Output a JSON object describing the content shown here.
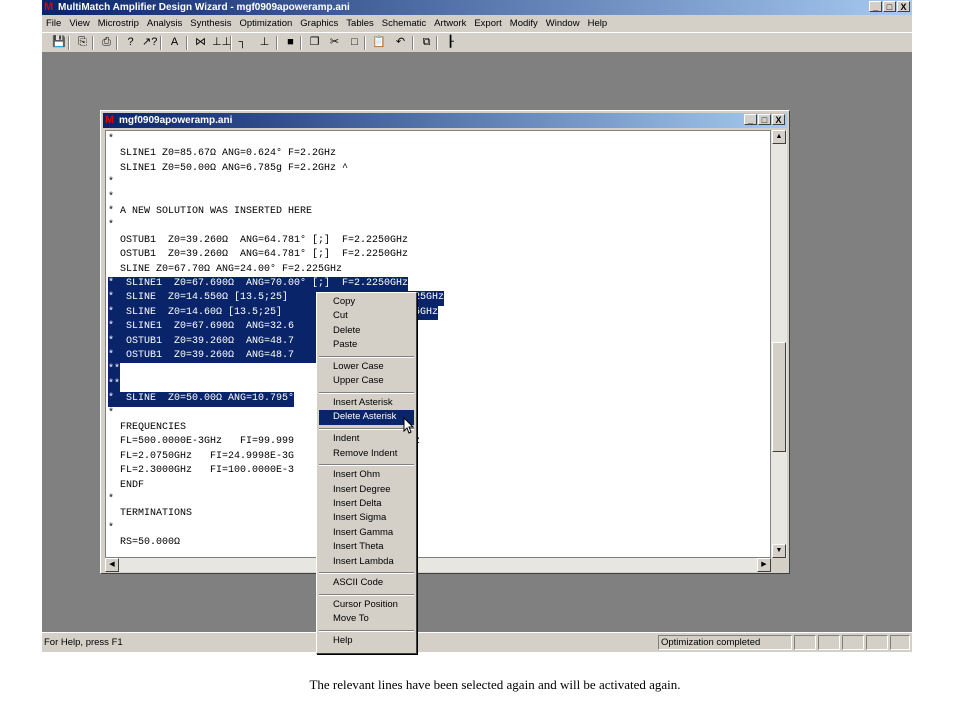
{
  "window": {
    "title": "MultiMatch Amplifier Design Wizard - mgf0909apoweramp.ani",
    "logo_glyph": "M",
    "controls": [
      "_",
      "□",
      "X"
    ]
  },
  "menu": [
    "File",
    "View",
    "Microstrip",
    "Analysis",
    "Synthesis",
    "Optimization",
    "Graphics",
    "Tables",
    "Schematic",
    "Artwork",
    "Export",
    "Modify",
    "Window",
    "Help"
  ],
  "toolbar_icons": [
    {
      "name": "save-icon",
      "glyph": "💾"
    },
    {
      "name": "open-icon",
      "glyph": "⎘"
    },
    {
      "name": "print-icon",
      "glyph": "⎙"
    },
    {
      "name": "help-icon",
      "glyph": "?"
    },
    {
      "name": "context-help-icon",
      "glyph": "↗?"
    },
    {
      "name": "amplifier-icon",
      "glyph": "A"
    },
    {
      "name": "ff-icon",
      "glyph": "⋈"
    },
    {
      "name": "tt-icon",
      "glyph": "⊥⊥"
    },
    {
      "name": "stub-icon",
      "glyph": "┐"
    },
    {
      "name": "ground-icon",
      "glyph": "⊥"
    },
    {
      "name": "block-icon",
      "glyph": "■"
    },
    {
      "name": "copy-icon",
      "glyph": "❐"
    },
    {
      "name": "cut-icon",
      "glyph": "✂"
    },
    {
      "name": "square-icon",
      "glyph": "□"
    },
    {
      "name": "paste-icon",
      "glyph": "📋"
    },
    {
      "name": "undo-icon",
      "glyph": "↶"
    },
    {
      "name": "frame-icon",
      "glyph": "⧉"
    },
    {
      "name": "pointer-icon",
      "glyph": "┠"
    }
  ],
  "document": {
    "title": "mgf0909apoweramp.ani",
    "logo_glyph": "M",
    "lines": [
      {
        "text": "*",
        "sel": false
      },
      {
        "text": "  SLINE1 Z0=85.67Ω ANG=0.624° F=2.2GHz",
        "sel": false
      },
      {
        "text": "  SLINE1 Z0=50.00Ω ANG=6.785g F=2.2GHz ^",
        "sel": false
      },
      {
        "text": "*",
        "sel": false
      },
      {
        "text": "*",
        "sel": false
      },
      {
        "text": "* A NEW SOLUTION WAS INSERTED HERE",
        "sel": false
      },
      {
        "text": "*",
        "sel": false
      },
      {
        "text": "  OSTUB1  Z0=39.260Ω  ANG=64.781° [;]  F=2.2250GHz",
        "sel": false
      },
      {
        "text": "  OSTUB1  Z0=39.260Ω  ANG=64.781° [;]  F=2.2250GHz",
        "sel": false
      },
      {
        "text": "  SLINE Z0=67.70Ω ANG=24.00° F=2.225GHz",
        "sel": false
      },
      {
        "text": "*  SLINE1  Z0=67.690Ω  ANG=70.00° [;]  F=2.2250GHz",
        "sel": true
      },
      {
        "text": "*  SLINE  Z0=14.550Ω [13.5;25]                F=2.225GHz",
        "sel": true
      },
      {
        "text": "*  SLINE  Z0=14.60Ω [13.5;25]                F=2.225GHz",
        "sel": true
      },
      {
        "text": "*  SLINE1  Z0=67.690Ω  ANG=32.6               50GHz",
        "sel": true
      },
      {
        "text": "*  OSTUB1  Z0=39.260Ω  ANG=48.7               50GHz",
        "sel": true
      },
      {
        "text": "*  OSTUB1  Z0=39.260Ω  ANG=48.7               50GHz",
        "sel": true
      },
      {
        "text": "**",
        "sel": true
      },
      {
        "text": "**",
        "sel": true
      },
      {
        "text": "*  SLINE  Z0=50.00Ω ANG=10.795°",
        "sel": true
      },
      {
        "text": "*",
        "sel": false
      },
      {
        "text": "  FREQUENCIES",
        "sel": false
      },
      {
        "text": "  FL=500.0000E-3GHz   FI=99.999              0000GHz",
        "sel": false
      },
      {
        "text": "  FL=2.0750GHz   FI=24.9998E-3G              Hz",
        "sel": false
      },
      {
        "text": "  FL=2.3000GHz   FI=100.0000E-3              GHz",
        "sel": false
      },
      {
        "text": "  ENDF",
        "sel": false
      },
      {
        "text": "*",
        "sel": false
      },
      {
        "text": "  TERMINATIONS",
        "sel": false
      },
      {
        "text": "*",
        "sel": false
      },
      {
        "text": "  RS=50.000Ω",
        "sel": false
      }
    ]
  },
  "context_menu": {
    "groups": [
      [
        "Copy",
        "Cut",
        "Delete",
        "Paste"
      ],
      [
        "Lower Case",
        "Upper Case"
      ],
      [
        "Insert Asterisk",
        "Delete Asterisk"
      ],
      [
        "Indent",
        "Remove Indent"
      ],
      [
        "Insert Ohm",
        "Insert Degree",
        "Insert Delta",
        "Insert Sigma",
        "Insert Gamma",
        "Insert Theta",
        "Insert Lambda"
      ],
      [
        "ASCII Code"
      ],
      [
        "Cursor Position",
        "Move To"
      ],
      [
        "Help"
      ]
    ],
    "highlighted": "Delete Asterisk"
  },
  "status": {
    "help_text": "For Help, press F1",
    "state_text": "Optimization completed"
  },
  "caption": "The relevant lines have been selected again and will be activated again."
}
